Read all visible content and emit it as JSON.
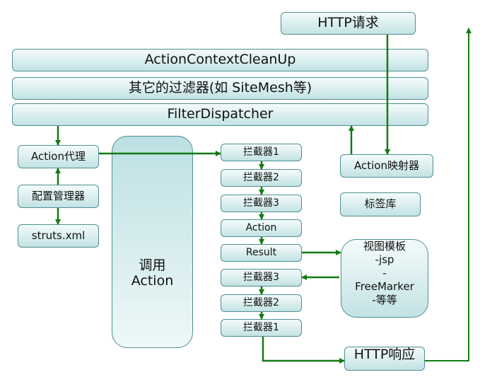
{
  "boxes": {
    "http_request": "HTTP请求",
    "action_context_cleanup": "ActionContextCleanUp",
    "other_filters": "其它的过滤器(如 SiteMesh等)",
    "filter_dispatcher": "FilterDispatcher",
    "action_proxy": "Action代理",
    "config_manager": "配置管理器",
    "struts_xml": "struts.xml",
    "invoke_action_line1": "调用",
    "invoke_action_line2": "Action",
    "interceptor1_in": "拦截器1",
    "interceptor2_in": "拦截器2",
    "interceptor3_in": "拦截器3",
    "action": "Action",
    "result": "Result",
    "interceptor3_out": "拦截器3",
    "interceptor2_out": "拦截器2",
    "interceptor1_out": "拦截器1",
    "action_mapper": "Action映射器",
    "tag_library": "标签库",
    "view_template_lines": [
      "视图模板",
      "-jsp",
      "-",
      "FreeMarker",
      "-等等"
    ],
    "http_response": "HTTP响应"
  },
  "colors": {
    "arrow": "#137a13",
    "border": "#4f8f92",
    "fill_top": "#f4fbfb",
    "fill_bottom": "#c3e2e4"
  }
}
